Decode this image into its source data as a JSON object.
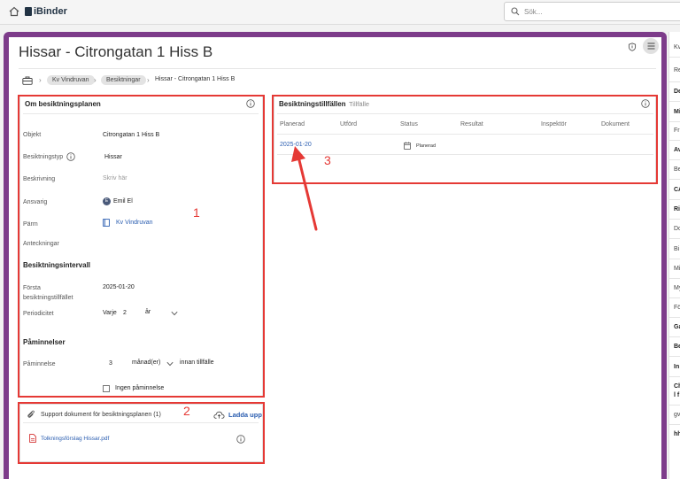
{
  "topbar": {
    "app_name": "iBinder",
    "search_placeholder": "Sök..."
  },
  "page": {
    "title": "Hissar - Citrongatan 1 Hiss B"
  },
  "breadcrumb": {
    "items": [
      "Kv Vindruvan",
      "Besiktningar"
    ],
    "current": "Hissar - Citrongatan 1 Hiss B"
  },
  "plan": {
    "title": "Om besiktningsplanen",
    "fields": {
      "object_label": "Objekt",
      "object_value": "Citrongatan 1 Hiss B",
      "type_label": "Besiktningstyp",
      "type_value": "Hissar",
      "description_label": "Beskrivning",
      "description_placeholder": "Skriv här",
      "responsible_label": "Ansvarig",
      "responsible_initial": "E",
      "responsible_value": "Emil El",
      "binder_label": "Pärm",
      "binder_value": "Kv Vindruvan",
      "notes_label": "Anteckningar"
    },
    "interval": {
      "heading": "Besiktningsintervall",
      "first_label_1": "Första",
      "first_label_2": "besiktningstillfället",
      "first_value": "2025-01-20",
      "periodicity_label": "Periodicitet",
      "every_label": "Varje",
      "count": "2",
      "unit": "år"
    },
    "reminders": {
      "heading": "Påminnelser",
      "reminder_label": "Påminnelse",
      "count": "3",
      "unit": "månad(er)",
      "suffix": "innan tillfälle",
      "no_reminder_label": "Ingen påminnelse",
      "no_reminder_checked": false
    }
  },
  "support": {
    "title": "Support dokument för besiktningsplanen (1)",
    "upload_label": "Ladda upp",
    "files": [
      {
        "name": "Tolkningsförslag Hissar.pdf"
      }
    ]
  },
  "occasions": {
    "title": "Besiktningstillfällen",
    "tab": "Tillfälle",
    "columns": [
      "Planerad",
      "Utförd",
      "Status",
      "Resultat",
      "Inspektör",
      "Dokument"
    ],
    "rows": [
      {
        "planned": "2025-01-20",
        "performed": "",
        "status": "Planerad",
        "result": "",
        "inspector": "",
        "documents": ""
      }
    ]
  },
  "annotations": {
    "labels": [
      "1",
      "2",
      "3"
    ],
    "color": "#e53935"
  },
  "right_panel": {
    "items": [
      "Kv",
      "Re",
      "De",
      "Mi",
      "Fr",
      "Av",
      "Be",
      "CA",
      "Ri",
      "Do",
      "Bi",
      "Mi",
      "My",
      "Fö",
      "Ga",
      "Be",
      "In",
      "Ch",
      "l f",
      "gv",
      "hh"
    ]
  },
  "colors": {
    "frame": "#7d3c8a",
    "link": "#2a5db0",
    "annotation": "#e53935"
  }
}
